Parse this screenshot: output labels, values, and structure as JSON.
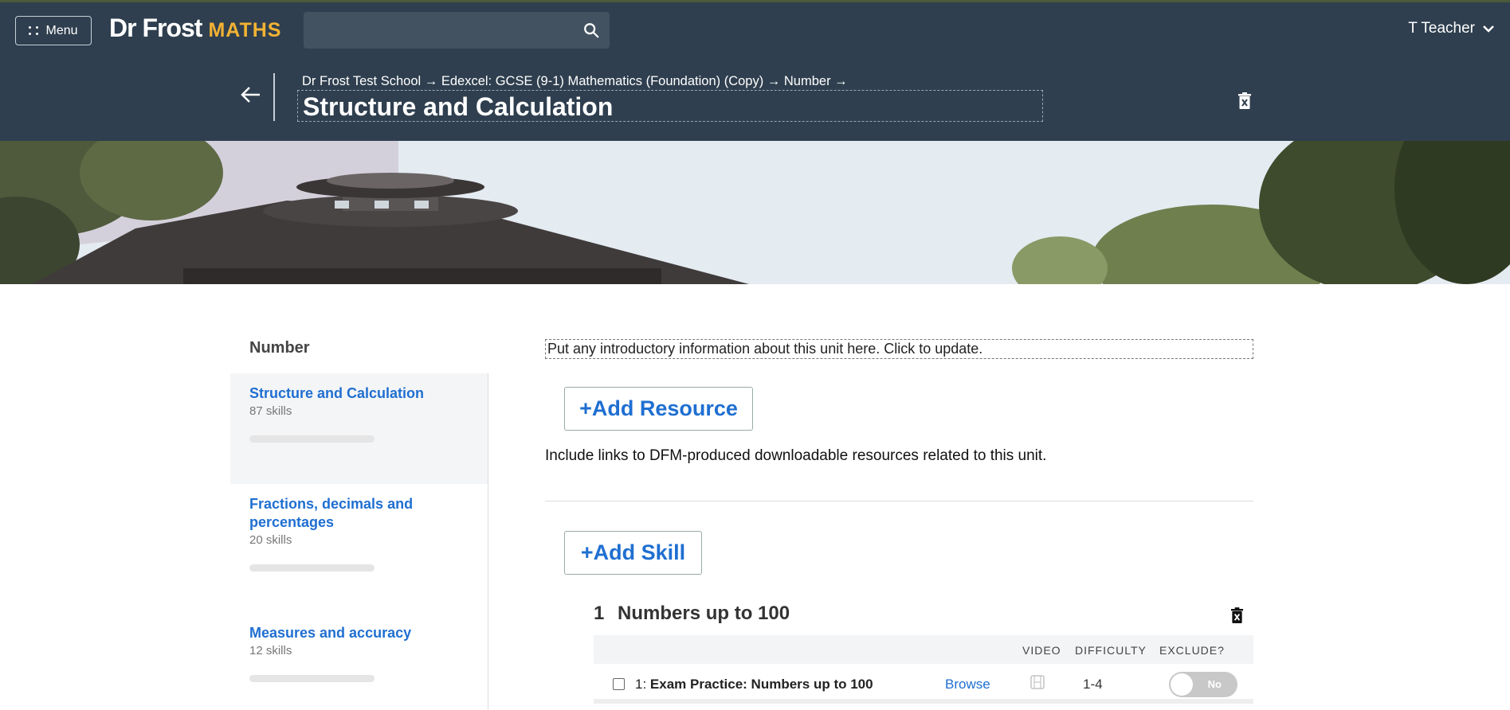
{
  "nav": {
    "menu_label": "Menu",
    "logo_main": "Dr Frost",
    "logo_sub": "MATHS",
    "search_placeholder": "",
    "user_name": "T Teacher"
  },
  "header": {
    "breadcrumb": "Dr Frost Test School → Edexcel: GCSE (9-1) Mathematics (Foundation) (Copy) → Number →",
    "title": "Structure and Calculation"
  },
  "sidebar": {
    "title": "Number",
    "items": [
      {
        "name": "Structure and Calculation",
        "count": "87 skills",
        "progress": 0
      },
      {
        "name": "Fractions, decimals and percentages",
        "count": "20 skills",
        "progress": 0
      },
      {
        "name": "Measures and accuracy",
        "count": "12 skills",
        "progress": 0
      }
    ]
  },
  "main": {
    "intro": "Put any introductory information about this unit here. Click to update.",
    "add_resource": "+Add Resource",
    "include_text": "Include links to DFM-produced downloadable resources related to this unit.",
    "add_skill": "+Add Skill",
    "section": {
      "number": "1",
      "title": "Numbers up to 100",
      "headers": {
        "video": "VIDEO",
        "difficulty": "DIFFICULTY",
        "exclude": "EXCLUDE?"
      },
      "rows": [
        {
          "index": "1:",
          "label": "Exam Practice: Numbers up to 100",
          "browse": "Browse",
          "difficulty": "1-4",
          "exclude": "No"
        }
      ]
    }
  },
  "colors": {
    "nav_bg": "#2f3f4f",
    "accent_blue": "#1f6fd1",
    "logo_gold": "#f2b233"
  }
}
